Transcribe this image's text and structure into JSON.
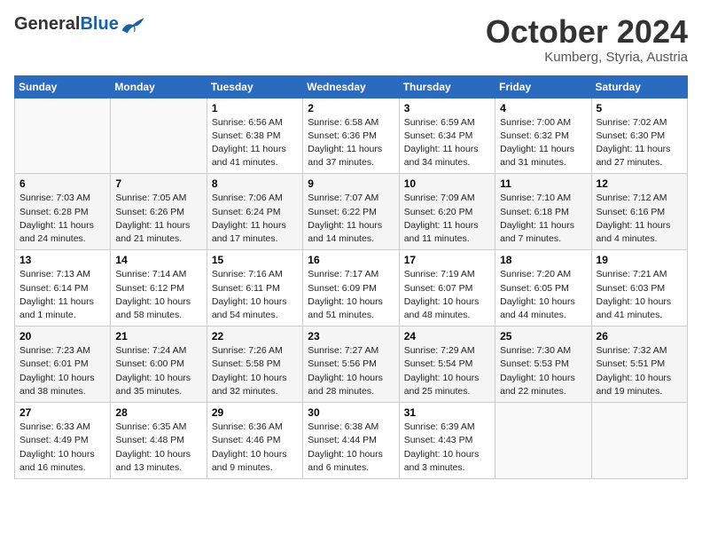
{
  "header": {
    "logo_general": "General",
    "logo_blue": "Blue",
    "month_title": "October 2024",
    "subtitle": "Kumberg, Styria, Austria"
  },
  "weekdays": [
    "Sunday",
    "Monday",
    "Tuesday",
    "Wednesday",
    "Thursday",
    "Friday",
    "Saturday"
  ],
  "weeks": [
    [
      {
        "day": "",
        "info": ""
      },
      {
        "day": "",
        "info": ""
      },
      {
        "day": "1",
        "info": "Sunrise: 6:56 AM\nSunset: 6:38 PM\nDaylight: 11 hours and 41 minutes."
      },
      {
        "day": "2",
        "info": "Sunrise: 6:58 AM\nSunset: 6:36 PM\nDaylight: 11 hours and 37 minutes."
      },
      {
        "day": "3",
        "info": "Sunrise: 6:59 AM\nSunset: 6:34 PM\nDaylight: 11 hours and 34 minutes."
      },
      {
        "day": "4",
        "info": "Sunrise: 7:00 AM\nSunset: 6:32 PM\nDaylight: 11 hours and 31 minutes."
      },
      {
        "day": "5",
        "info": "Sunrise: 7:02 AM\nSunset: 6:30 PM\nDaylight: 11 hours and 27 minutes."
      }
    ],
    [
      {
        "day": "6",
        "info": "Sunrise: 7:03 AM\nSunset: 6:28 PM\nDaylight: 11 hours and 24 minutes."
      },
      {
        "day": "7",
        "info": "Sunrise: 7:05 AM\nSunset: 6:26 PM\nDaylight: 11 hours and 21 minutes."
      },
      {
        "day": "8",
        "info": "Sunrise: 7:06 AM\nSunset: 6:24 PM\nDaylight: 11 hours and 17 minutes."
      },
      {
        "day": "9",
        "info": "Sunrise: 7:07 AM\nSunset: 6:22 PM\nDaylight: 11 hours and 14 minutes."
      },
      {
        "day": "10",
        "info": "Sunrise: 7:09 AM\nSunset: 6:20 PM\nDaylight: 11 hours and 11 minutes."
      },
      {
        "day": "11",
        "info": "Sunrise: 7:10 AM\nSunset: 6:18 PM\nDaylight: 11 hours and 7 minutes."
      },
      {
        "day": "12",
        "info": "Sunrise: 7:12 AM\nSunset: 6:16 PM\nDaylight: 11 hours and 4 minutes."
      }
    ],
    [
      {
        "day": "13",
        "info": "Sunrise: 7:13 AM\nSunset: 6:14 PM\nDaylight: 11 hours and 1 minute."
      },
      {
        "day": "14",
        "info": "Sunrise: 7:14 AM\nSunset: 6:12 PM\nDaylight: 10 hours and 58 minutes."
      },
      {
        "day": "15",
        "info": "Sunrise: 7:16 AM\nSunset: 6:11 PM\nDaylight: 10 hours and 54 minutes."
      },
      {
        "day": "16",
        "info": "Sunrise: 7:17 AM\nSunset: 6:09 PM\nDaylight: 10 hours and 51 minutes."
      },
      {
        "day": "17",
        "info": "Sunrise: 7:19 AM\nSunset: 6:07 PM\nDaylight: 10 hours and 48 minutes."
      },
      {
        "day": "18",
        "info": "Sunrise: 7:20 AM\nSunset: 6:05 PM\nDaylight: 10 hours and 44 minutes."
      },
      {
        "day": "19",
        "info": "Sunrise: 7:21 AM\nSunset: 6:03 PM\nDaylight: 10 hours and 41 minutes."
      }
    ],
    [
      {
        "day": "20",
        "info": "Sunrise: 7:23 AM\nSunset: 6:01 PM\nDaylight: 10 hours and 38 minutes."
      },
      {
        "day": "21",
        "info": "Sunrise: 7:24 AM\nSunset: 6:00 PM\nDaylight: 10 hours and 35 minutes."
      },
      {
        "day": "22",
        "info": "Sunrise: 7:26 AM\nSunset: 5:58 PM\nDaylight: 10 hours and 32 minutes."
      },
      {
        "day": "23",
        "info": "Sunrise: 7:27 AM\nSunset: 5:56 PM\nDaylight: 10 hours and 28 minutes."
      },
      {
        "day": "24",
        "info": "Sunrise: 7:29 AM\nSunset: 5:54 PM\nDaylight: 10 hours and 25 minutes."
      },
      {
        "day": "25",
        "info": "Sunrise: 7:30 AM\nSunset: 5:53 PM\nDaylight: 10 hours and 22 minutes."
      },
      {
        "day": "26",
        "info": "Sunrise: 7:32 AM\nSunset: 5:51 PM\nDaylight: 10 hours and 19 minutes."
      }
    ],
    [
      {
        "day": "27",
        "info": "Sunrise: 6:33 AM\nSunset: 4:49 PM\nDaylight: 10 hours and 16 minutes."
      },
      {
        "day": "28",
        "info": "Sunrise: 6:35 AM\nSunset: 4:48 PM\nDaylight: 10 hours and 13 minutes."
      },
      {
        "day": "29",
        "info": "Sunrise: 6:36 AM\nSunset: 4:46 PM\nDaylight: 10 hours and 9 minutes."
      },
      {
        "day": "30",
        "info": "Sunrise: 6:38 AM\nSunset: 4:44 PM\nDaylight: 10 hours and 6 minutes."
      },
      {
        "day": "31",
        "info": "Sunrise: 6:39 AM\nSunset: 4:43 PM\nDaylight: 10 hours and 3 minutes."
      },
      {
        "day": "",
        "info": ""
      },
      {
        "day": "",
        "info": ""
      }
    ]
  ]
}
